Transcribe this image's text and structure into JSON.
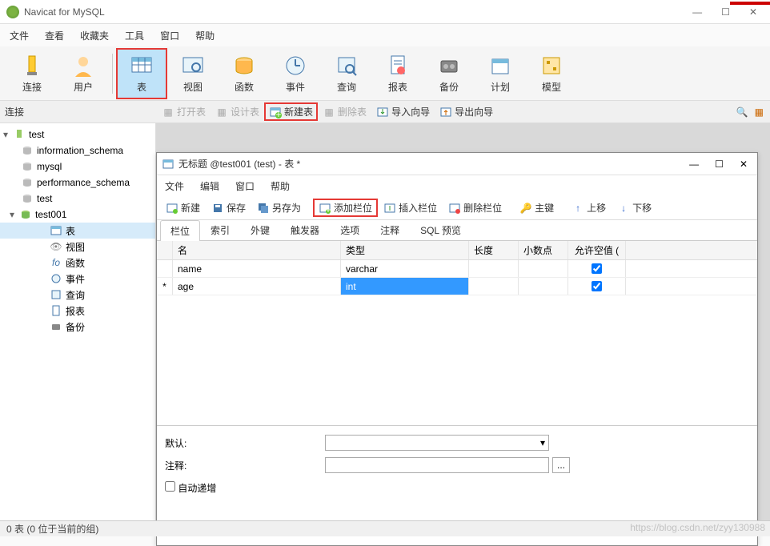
{
  "titlebar": {
    "title": "Navicat for MySQL"
  },
  "menubar": {
    "items": [
      "文件",
      "查看",
      "收藏夹",
      "工具",
      "窗口",
      "帮助"
    ]
  },
  "toolbar": {
    "items": [
      {
        "label": "连接"
      },
      {
        "label": "用户"
      },
      {
        "label": "表"
      },
      {
        "label": "视图"
      },
      {
        "label": "函数"
      },
      {
        "label": "事件"
      },
      {
        "label": "查询"
      },
      {
        "label": "报表"
      },
      {
        "label": "备份"
      },
      {
        "label": "计划"
      },
      {
        "label": "模型"
      }
    ]
  },
  "subbar": {
    "label": "连接",
    "tools": [
      "打开表",
      "设计表",
      "新建表",
      "删除表",
      "导入向导",
      "导出向导"
    ]
  },
  "tree": {
    "root": {
      "label": "test"
    },
    "dbs": [
      "information_schema",
      "mysql",
      "performance_schema",
      "test"
    ],
    "active_db": "test001",
    "children": [
      "表",
      "视图",
      "函数",
      "事件",
      "查询",
      "报表",
      "备份"
    ]
  },
  "child_window": {
    "title": "无标题 @test001 (test) - 表 *",
    "menubar": [
      "文件",
      "编辑",
      "窗口",
      "帮助"
    ],
    "toolbar": [
      "新建",
      "保存",
      "另存为",
      "添加栏位",
      "插入栏位",
      "删除栏位",
      "主键",
      "上移",
      "下移"
    ],
    "tabs": [
      "栏位",
      "索引",
      "外键",
      "触发器",
      "选项",
      "注释",
      "SQL 预览"
    ],
    "grid": {
      "headers": {
        "name": "名",
        "type": "类型",
        "length": "长度",
        "decimal": "小数点",
        "null": "允许空值 ("
      },
      "rows": [
        {
          "marker": "",
          "name": "name",
          "type": "varchar",
          "length": "",
          "decimal": "",
          "null_checked": true,
          "type_selected": false
        },
        {
          "marker": "*",
          "name": "age",
          "type": "int",
          "length": "",
          "decimal": "",
          "null_checked": true,
          "type_selected": true
        }
      ]
    },
    "form": {
      "default_label": "默认:",
      "comment_label": "注释:",
      "autoinc_label": "自动递增"
    }
  },
  "statusbar": {
    "text": "0 表 (0 位于当前的组)"
  },
  "watermark": "https://blog.csdn.net/zyy130988"
}
